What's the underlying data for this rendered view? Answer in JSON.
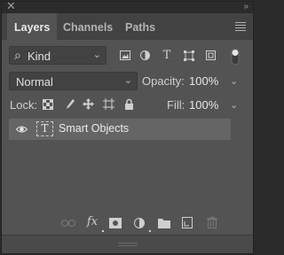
{
  "panel": {
    "close_glyph": "✕",
    "collapse_glyph": "»",
    "tabs": [
      {
        "label": "Layers",
        "active": true
      },
      {
        "label": "Channels",
        "active": false
      },
      {
        "label": "Paths",
        "active": false
      }
    ]
  },
  "filter": {
    "search_glyph": "⌕",
    "kind_label": "Kind",
    "chevron": "⌄",
    "filter_icons": [
      "image-filter-icon",
      "adjustment-filter-icon",
      "type-filter-icon",
      "shape-filter-icon",
      "smart-object-filter-icon"
    ],
    "type_glyph": "T"
  },
  "blend": {
    "mode_value": "Normal",
    "chevron": "⌄",
    "opacity_label": "Opacity:",
    "opacity_value": "100%"
  },
  "lock": {
    "label": "Lock:",
    "fill_label": "Fill:",
    "fill_value": "100%"
  },
  "layers": [
    {
      "name": "Smart Objects",
      "thumb_glyph": "T",
      "visible": true
    }
  ],
  "bottom_bar": {
    "fx_label": "fx",
    "icons": [
      "link-icon",
      "fx-icon",
      "add-mask-icon",
      "adjustment-layer-icon",
      "new-group-icon",
      "new-layer-icon",
      "delete-layer-icon"
    ]
  },
  "colors": {
    "panel_bg": "#535353",
    "tab_bar_bg": "#424242",
    "selected_layer_bg": "#656565",
    "text": "#d8d8d8"
  }
}
